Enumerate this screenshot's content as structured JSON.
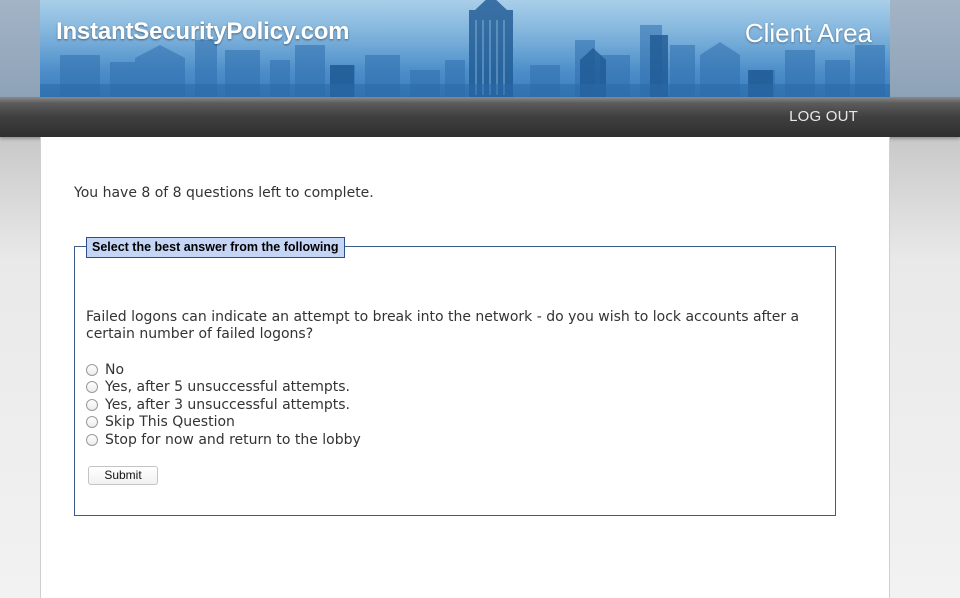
{
  "header": {
    "site_name": "InstantSecurityPolicy.com",
    "area_title": "Client Area"
  },
  "nav": {
    "logout_label": "LOG OUT"
  },
  "main": {
    "progress_text": "You have 8 of 8 questions left to complete.",
    "question_panel": {
      "legend": "Select the best answer from the following",
      "question": "Failed logons can indicate an attempt to break into the network - do you wish to lock accounts after a certain number of failed logons?",
      "options": [
        {
          "label": "No",
          "selected": false
        },
        {
          "label": "Yes, after 5 unsuccessful attempts.",
          "selected": false
        },
        {
          "label": "Yes, after 3 unsuccessful attempts.",
          "selected": false
        },
        {
          "label": "Skip This Question",
          "selected": false
        },
        {
          "label": "Stop for now and return to the lobby",
          "selected": false
        }
      ],
      "submit_label": "Submit"
    }
  },
  "colors": {
    "banner_blue": "#4e8fca",
    "legend_bg": "#c5d5f5",
    "panel_border": "#3d5b8c",
    "navbar": "#3f3f3f"
  }
}
